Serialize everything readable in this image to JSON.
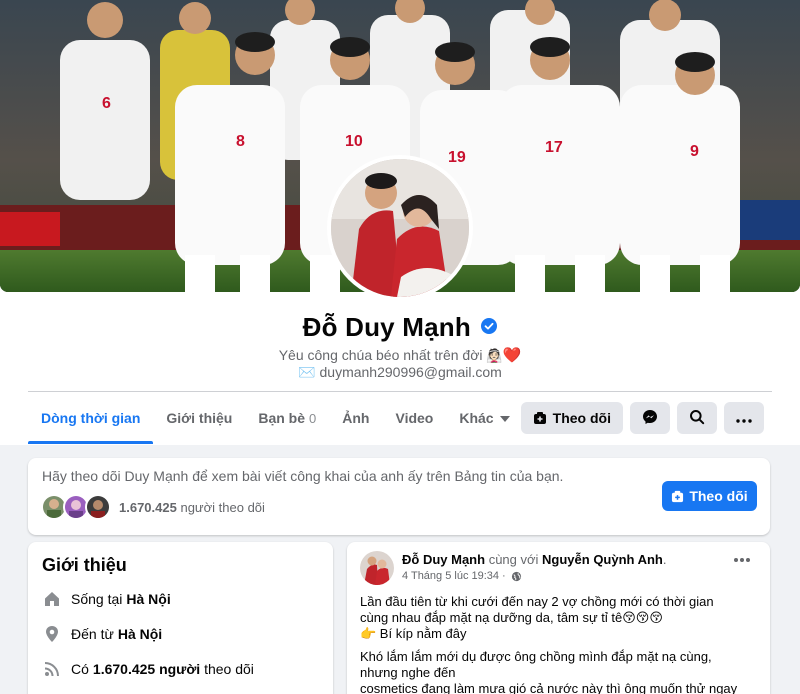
{
  "profile": {
    "name": "Đỗ Duy Mạnh",
    "bio_text": "Yêu công chúa béo nhất trên đời",
    "bio_emoji": "👰🏻",
    "bio_heart": "❤️",
    "email_icon": "✉️",
    "email": "duymanh290996@gmail.com"
  },
  "tabs": [
    {
      "label": "Dòng thời gian"
    },
    {
      "label": "Giới thiệu"
    },
    {
      "label": "Bạn bè",
      "count": "0"
    },
    {
      "label": "Ảnh"
    },
    {
      "label": "Video"
    },
    {
      "label": "Khác"
    }
  ],
  "actions": {
    "follow_label": "Theo dõi"
  },
  "notice": {
    "text": "Hãy theo dõi Duy Mạnh để xem bài viết công khai của anh ấy trên Bảng tin của bạn.",
    "follower_count": "1.670.425",
    "follower_suffix": "người theo dõi",
    "follow_label": "Theo dõi"
  },
  "intro": {
    "title": "Giới thiệu",
    "lives_prefix": "Sống tại",
    "lives_place": "Hà Nội",
    "from_prefix": "Đến từ",
    "from_place": "Hà Nội",
    "followers_prefix": "Có",
    "followers_count": "1.670.425 người",
    "followers_suffix": "theo dõi"
  },
  "post": {
    "author": "Đỗ Duy Mạnh",
    "with_word": "cùng với",
    "tagged": "Nguyễn Quỳnh Anh",
    "tagged_end": ".",
    "date": "4 Tháng 5 lúc 19:34",
    "dot": "·",
    "lines": [
      "Lần đầu tiên từ khi cưới đến nay 2 vợ chồng mới có thời gian",
      "cùng nhau đắp mặt nạ dưỡng da, tâm sự tỉ tê😚😚😚",
      "👉 Bí kíp nằm đây",
      "Khó lắm lắm mới dụ được ông chồng mình đắp mặt nạ cùng,",
      "nhưng nghe đến",
      "cosmetics đang làm mưa gió cả nước này thì ông muốn thử ngay"
    ]
  },
  "colors": {
    "accent": "#1877f2",
    "background": "#f0f2f5",
    "secondary_text": "#65676b"
  },
  "icons": {
    "verified": "verified-badge-icon",
    "follow": "follow-icon",
    "messenger": "messenger-icon",
    "search": "search-icon",
    "more": "more-icon",
    "home": "home-icon",
    "location": "location-pin-icon",
    "rss": "rss-icon",
    "globe": "globe-icon"
  }
}
